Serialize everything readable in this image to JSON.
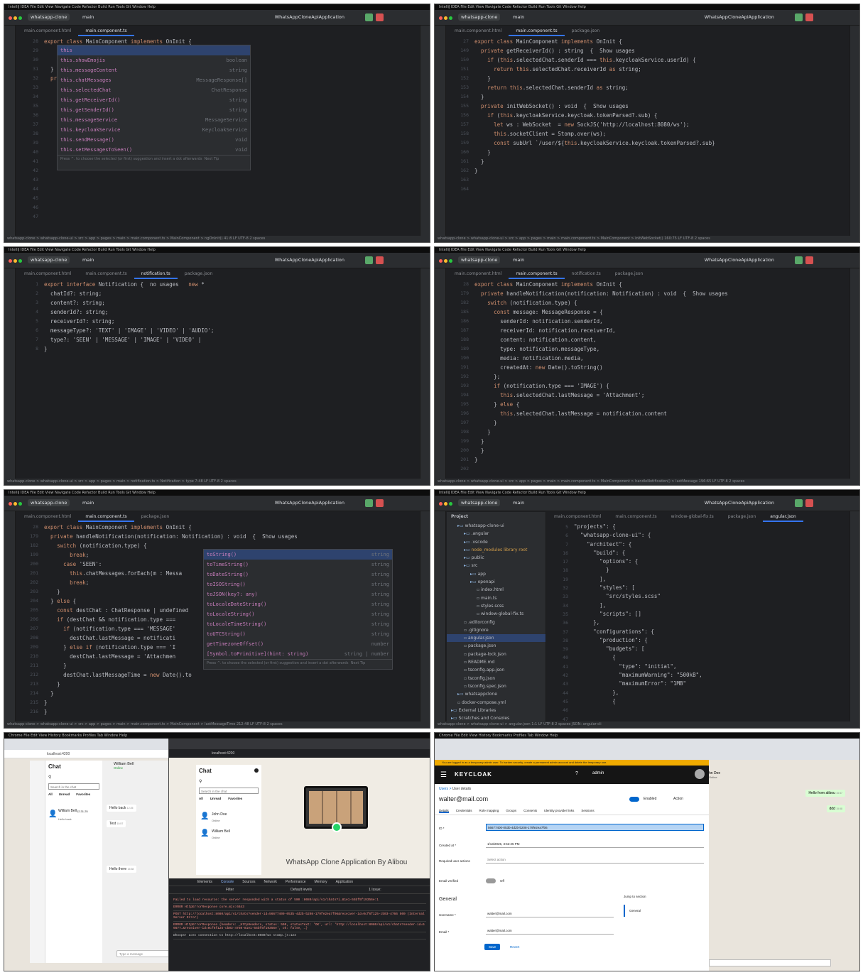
{
  "ide": {
    "project": "whatsapp-clone",
    "branch": "main",
    "run_config": "WhatsAppCloneApiApplication",
    "menu": "IntelliJ IDEA  File  Edit  View  Navigate  Code  Refactor  Build  Run  Tools  Git  Window  Help"
  },
  "p1": {
    "tabs": [
      "main.component.html",
      "main.component.ts"
    ],
    "lines": [
      "28",
      "",
      "29",
      "30",
      "31",
      "32",
      "33",
      "34",
      "35",
      "36",
      "37",
      "38",
      "39",
      "40",
      "41",
      "42",
      "43",
      "44",
      "45",
      "46",
      "47"
    ],
    "code": [
      {
        "t": "export class MainComponent implements OnInit {",
        "c": "kw"
      },
      {
        "t": "",
        "c": ""
      },
      {
        "t": "",
        "c": ""
      },
      {
        "t": "",
        "c": ""
      },
      {
        "t": "",
        "c": ""
      },
      {
        "t": "",
        "c": ""
      },
      {
        "t": "",
        "c": ""
      },
      {
        "t": "",
        "c": ""
      },
      {
        "t": "",
        "c": ""
      },
      {
        "t": "",
        "c": ""
      },
      {
        "t": "",
        "c": ""
      },
      {
        "t": "",
        "c": ""
      },
      {
        "t": "",
        "c": ""
      },
      {
        "t": "",
        "c": ""
      },
      {
        "t": "    this",
        "c": "kw"
      },
      {
        "t": "    this.getAllChats();",
        "c": ""
      },
      {
        "t": "  }",
        "c": ""
      },
      {
        "t": "",
        "c": ""
      },
      {
        "t": "  private getAllChats() : void  {  Show usages",
        "c": ""
      },
      {
        "t": "    this.chatService.getChatsByReceiver()",
        "c": ""
      },
      {
        "t": "      .subscribe({",
        "c": ""
      }
    ],
    "popup": [
      [
        "this",
        ""
      ],
      [
        "this.showEmojis",
        "boolean"
      ],
      [
        "this.messageContent",
        "string"
      ],
      [
        "this.chatMessages",
        "MessageResponse[]"
      ],
      [
        "this.selectedChat",
        "ChatResponse"
      ],
      [
        "this.getReceiverId()",
        "string"
      ],
      [
        "this.getSenderId()",
        "string"
      ],
      [
        "this.messageService",
        "MessageService"
      ],
      [
        "this.keycloakService",
        "KeycloakService"
      ],
      [
        "this.sendMessage()",
        "void"
      ],
      [
        "this.setMessagesToSeen()",
        "void"
      ]
    ],
    "popup_hint": "Press ^. to choose the selected (or first) suggestion and insert a dot afterwards  Next Tip",
    "status": "whatsapp-clone > whatsapp-clone-ui > src > app > pages > main > main.component.ts > MainComponent > ngOnInit()      41:8   LF  UTF-8  2 spaces"
  },
  "p2": {
    "tabs": [
      "main.component.html",
      "main.component.ts",
      "package.json"
    ],
    "lines": [
      "27",
      "149",
      "150",
      "151",
      "152",
      "153",
      "154",
      "155",
      "156",
      "157",
      "158",
      "159",
      "160",
      "161",
      "162",
      "163",
      "164"
    ],
    "code": [
      "export class MainComponent implements OnInit {",
      "  private getReceiverId() : string  {  Show usages",
      "    if (this.selectedChat.senderId === this.keycloakService.userId) {",
      "      return this.selectedChat.receiverId as string;",
      "    }",
      "    return this.selectedChat.senderId as string;",
      "  }",
      "",
      "  private initWebSocket() : void  {  Show usages",
      "    if (this.keycloakService.keycloak.tokenParsed?.sub) {",
      "      let ws : WebSocket  = new SockJS('http://localhost:8080/ws');",
      "      this.socketClient = Stomp.over(ws);",
      "      const subUrl `/user/${this.keycloakService.keycloak.tokenParsed?.sub}",
      "    }",
      "  }",
      "}",
      ""
    ],
    "status": "whatsapp-clone > whatsapp-clone-ui > src > app > pages > main > main.component.ts > MainComponent > initWebSocket()      160:75  LF  UTF-8  2 spaces"
  },
  "p3": {
    "tabs": [
      "main.component.html",
      "main.component.ts",
      "notification.ts",
      "package.json"
    ],
    "lines": [
      "1",
      "2",
      "3",
      "4",
      "5",
      "6",
      "7",
      "8"
    ],
    "code": [
      "export interface Notification {  no usages   new *",
      "  chatId?: string;",
      "  content?: string;",
      "  senderId?: string;",
      "  receiverId?: string;",
      "  messageType?: 'TEXT' | 'IMAGE' | 'VIDEO' | 'AUDIO';",
      "  type?: 'SEEN' | 'MESSAGE' | 'IMAGE' | 'VIDEO' |",
      "}"
    ],
    "status": "whatsapp-clone > whatsapp-clone-ui > src > app > pages > main > notification.ts > Notification > type      7:48  LF  UTF-8  2 spaces"
  },
  "p4": {
    "tabs": [
      "main.component.html",
      "main.component.ts",
      "notification.ts",
      "package.json"
    ],
    "lines": [
      "28",
      "179",
      "182",
      "185",
      "186",
      "187",
      "188",
      "189",
      "190",
      "191",
      "192",
      "193",
      "194",
      "195",
      "196",
      "197",
      "198",
      "199",
      "200",
      "201",
      "202"
    ],
    "code": [
      "export class MainComponent implements OnInit {",
      "  private handleNotification(notification: Notification) : void  {  Show usages",
      "    switch (notification.type) {",
      "      const message: MessageResponse = {",
      "        senderId: notification.senderId,",
      "        receiverId: notification.receiverId,",
      "        content: notification.content,",
      "        type: notification.messageType,",
      "        media: notification.media,",
      "        createdAt: new Date().toString()",
      "      };",
      "      if (notification.type === 'IMAGE') {",
      "        this.selectedChat.lastMessage = 'Attachment';",
      "      } else {",
      "        this.selectedChat.lastMessage = notification.content",
      "      }",
      "    }",
      "  }",
      "  }",
      "}",
      ""
    ],
    "status": "whatsapp-clone > whatsapp-clone-ui > src > app > pages > main > main.component.ts > MainComponent > handleNotification() > lastMessage      196:65  LF  UTF-8  2 spaces"
  },
  "p5": {
    "tabs": [
      "main.component.html",
      "main.component.ts",
      "package.json"
    ],
    "lines": [
      "28",
      "179",
      "182",
      "199",
      "200",
      "201",
      "202",
      "203",
      "204",
      "205",
      "206",
      "207",
      "208",
      "209",
      "210",
      "211",
      "212",
      "213",
      "214",
      "215",
      "216"
    ],
    "code": [
      "export class MainComponent implements OnInit {",
      "  private handleNotification(notification: Notification) : void  {  Show usages",
      "    switch (notification.type) {",
      "        break;",
      "      case 'SEEN':",
      "        this.chatMessages.forEach(m : Messa",
      "        break;",
      "    }",
      "  } else {",
      "    const destChat : ChatResponse | undefined",
      "    if (destChat && notification.type ===",
      "      if (notification.type === 'MESSAGE'",
      "        destChat.lastMessage = notificati",
      "      } else if (notification.type === 'I",
      "        destChat.lastMessage = 'Attachmen",
      "      }",
      "      destChat.lastMessageTime = new Date().to",
      "    }",
      "  }",
      "}",
      "}"
    ],
    "popup": [
      [
        "toString()",
        "string"
      ],
      [
        "toTimeString()",
        "string"
      ],
      [
        "toDateString()",
        "string"
      ],
      [
        "toISOString()",
        "string"
      ],
      [
        "toJSON(key?: any)",
        "string"
      ],
      [
        "toLocaleDateString()",
        "string"
      ],
      [
        "toLocaleString()",
        "string"
      ],
      [
        "toLocaleTimeString()",
        "string"
      ],
      [
        "toUTCString()",
        "string"
      ],
      [
        "getTimezoneOffset()",
        "number"
      ],
      [
        "[Symbol.toPrimitive](hint: string)",
        "string | number"
      ]
    ],
    "popup_hint": "Press ^. to choose the selected (or first) suggestion and insert a dot afterwards  Next Tip",
    "status": "whatsapp-clone > whatsapp-clone-ui > src > app > pages > main > main.component.ts > MainComponent > lastMessageTime      212:48  LF  UTF-8  2 spaces"
  },
  "p6": {
    "tabs": [
      "main.component.html",
      "main.component.ts",
      "window-global-fix.ts",
      "package.json",
      "angular.json"
    ],
    "tree_title": "Project",
    "tree": [
      {
        "t": "whatsapp-clone-ui",
        "d": 1,
        "k": "folder"
      },
      {
        "t": ".angular",
        "d": 2,
        "k": "folder"
      },
      {
        "t": ".vscode",
        "d": 2,
        "k": "folder"
      },
      {
        "t": "node_modules  library root",
        "d": 2,
        "k": "folder-o"
      },
      {
        "t": "public",
        "d": 2,
        "k": "folder"
      },
      {
        "t": "src",
        "d": 2,
        "k": "folder"
      },
      {
        "t": "app",
        "d": 3,
        "k": "folder"
      },
      {
        "t": "openapi",
        "d": 3,
        "k": "folder"
      },
      {
        "t": "index.html",
        "d": 4,
        "k": "file"
      },
      {
        "t": "main.ts",
        "d": 4,
        "k": "file"
      },
      {
        "t": "styles.scss",
        "d": 4,
        "k": "file"
      },
      {
        "t": "window-global-fix.ts",
        "d": 4,
        "k": "file"
      },
      {
        "t": ".editorconfig",
        "d": 2,
        "k": "file"
      },
      {
        "t": ".gitignore",
        "d": 2,
        "k": "file"
      },
      {
        "t": "angular.json",
        "d": 2,
        "k": "sel"
      },
      {
        "t": "package.json",
        "d": 2,
        "k": "file"
      },
      {
        "t": "package-lock.json",
        "d": 2,
        "k": "file"
      },
      {
        "t": "README.md",
        "d": 2,
        "k": "file"
      },
      {
        "t": "tsconfig.app.json",
        "d": 2,
        "k": "file"
      },
      {
        "t": "tsconfig.json",
        "d": 2,
        "k": "file"
      },
      {
        "t": "tsconfig.spec.json",
        "d": 2,
        "k": "file"
      },
      {
        "t": "whatsappclone",
        "d": 1,
        "k": "folder"
      },
      {
        "t": "docker-compose.yml",
        "d": 1,
        "k": "file"
      },
      {
        "t": "External Libraries",
        "d": 0,
        "k": "folder"
      },
      {
        "t": "Scratches and Consoles",
        "d": 0,
        "k": "folder"
      }
    ],
    "lines": [
      "5",
      "6",
      "7",
      "16",
      "17",
      "18",
      "19",
      "32",
      "33",
      "34",
      "35",
      "36",
      "37",
      "38",
      "39",
      "40",
      "41",
      "42",
      "43",
      "44",
      "45",
      "46",
      "47"
    ],
    "code": [
      "\"projects\": {",
      "  \"whatsapp-clone-ui\": {",
      "    \"architect\": {",
      "      \"build\": {",
      "        \"options\": {",
      "",
      "          }",
      "        ],",
      "        \"styles\": [",
      "          \"src/styles.scss\"",
      "        ],",
      "        \"scripts\": []",
      "      },",
      "      \"configurations\": {",
      "        \"production\": {",
      "          \"budgets\": [",
      "            {",
      "              \"type\": \"initial\",",
      "              \"maximumWarning\": \"500kB\",",
      "              \"maximumError\": \"1MB\"",
      "            },",
      "            {",
      ""
    ],
    "status": "whatsapp-clone > whatsapp-clone-ui > angular.json      1:1  LF  UTF-8  2 spaces  JSON: angular-cli"
  },
  "p7": {
    "url": "localhost:4200",
    "chat_title": "Chat",
    "search_placeholder": "Search in the chat",
    "filters": [
      "All",
      "Unread",
      "Favorites"
    ],
    "contact": {
      "name": "William Bell",
      "time": "12.31.25",
      "sub": "Hello back",
      "time2": "15:80"
    },
    "header": {
      "name": "William Bell",
      "status": "Online"
    },
    "bubbles": [
      {
        "t": "Hello back",
        "s": "12:25"
      },
      {
        "t": "Test",
        "s": "15:57"
      },
      {
        "t": "Hello there",
        "s": "15:58"
      }
    ],
    "msg_placeholder": "Type a message",
    "inner": {
      "url": "localhost:4200",
      "title": "Chat",
      "search": "Search in the chat",
      "filters": [
        "All",
        "Unread",
        "Favorites"
      ],
      "contacts": [
        {
          "name": "John Doe",
          "status": "Online"
        },
        {
          "name": "William Bell",
          "status": "Online"
        }
      ],
      "hero": "WhatsApp Clone Application By Alibou"
    },
    "devtools": {
      "tabs": [
        "Elements",
        "Console",
        "Sources",
        "Network",
        "Performance",
        "Memory",
        "Application"
      ],
      "filter": "Filter",
      "levels": "Default levels",
      "issues": "1 Issue:",
      "lines": [
        "Failed to load resource: the server responded with a status of 500   :8080/api/v1/chats?i…81e1-55bf5f19356e:1",
        "ERROR  HttpErrorResponse                                                        core.mjs:6643",
        "POST http://localhost:8080/api/v1/chats?sender-id=56677400-053b-4d2b-b208-179fe2ea7f06&receiver-id=0cf6f125-cb03-4766 500 (Internal Server Error)",
        "ERROR  HttpErrorResponse {headers: _HttpHeaders, status: 500, statusText: 'OK', url: 'http://localhost:8080/api/v1/chats?sender-id=56677…&receiver-id=0cf6f125-cb03-4760-81e1-55bf5f19356e', ok: false, …}",
        "Whoops! Lost connection to http://localhost:8080/ws                            stomp.js:124"
      ]
    }
  },
  "p8": {
    "banner": "You are logged in as a temporary admin user. To harden security, create a permanent admin account and delete the temporary one.",
    "brand": "KEYCLOAK",
    "admin": "admin",
    "breadcrumb": [
      "Users",
      "User details"
    ],
    "user": "walter@mail.com",
    "enabled": "Enabled",
    "action": "Action",
    "tabs": [
      "Details",
      "Credentials",
      "Role mapping",
      "Groups",
      "Consents",
      "Identity provider links",
      "Sessions"
    ],
    "id_label": "ID *",
    "id_value": "56677400-053b-4d2b-b208-179fe2ea7f06",
    "created_label": "Created at *",
    "created_value": "1/13/2025, 3:52:25 PM",
    "req_label": "Required user actions",
    "req_placeholder": "Select action",
    "email_verified": "Email verified",
    "off": "Off",
    "general": "General",
    "jump": "Jump to section",
    "jump_item": "General",
    "username_label": "Username *",
    "username_value": "walter@mail.com",
    "email_label": "Email *",
    "email_value": "walter@mail.com",
    "save": "Save",
    "revert": "Revert",
    "side_name": "hn Doe",
    "side_status": "Online",
    "msgs": [
      {
        "t": "Hello from alibou",
        "s": "15:57"
      },
      {
        "t": "ddd",
        "s": "15:58"
      }
    ]
  }
}
